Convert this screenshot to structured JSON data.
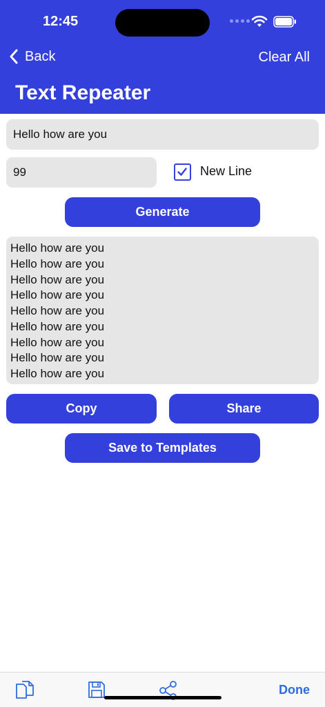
{
  "status_bar": {
    "time": "12:45"
  },
  "nav": {
    "back_label": "Back",
    "clear_all_label": "Clear All",
    "title": "Text Repeater"
  },
  "form": {
    "text_value": "Hello how are you",
    "count_value": "99",
    "new_line_checked": true,
    "new_line_label": "New Line",
    "generate_label": "Generate"
  },
  "output": {
    "lines": [
      "Hello how are you",
      "Hello how are you",
      "Hello how are you",
      "Hello how are you",
      "Hello how are you",
      "Hello how are you",
      "Hello how are you",
      "Hello how are you",
      "Hello how are you"
    ]
  },
  "actions": {
    "copy_label": "Copy",
    "share_label": "Share",
    "save_templates_label": "Save to Templates"
  },
  "toolbar": {
    "icons": [
      "copy-icon",
      "save-icon",
      "share-icon"
    ],
    "done_label": "Done"
  },
  "colors": {
    "accent": "#3440dc",
    "field_bg": "#e6e6e6",
    "done_text": "#2f6be0"
  }
}
